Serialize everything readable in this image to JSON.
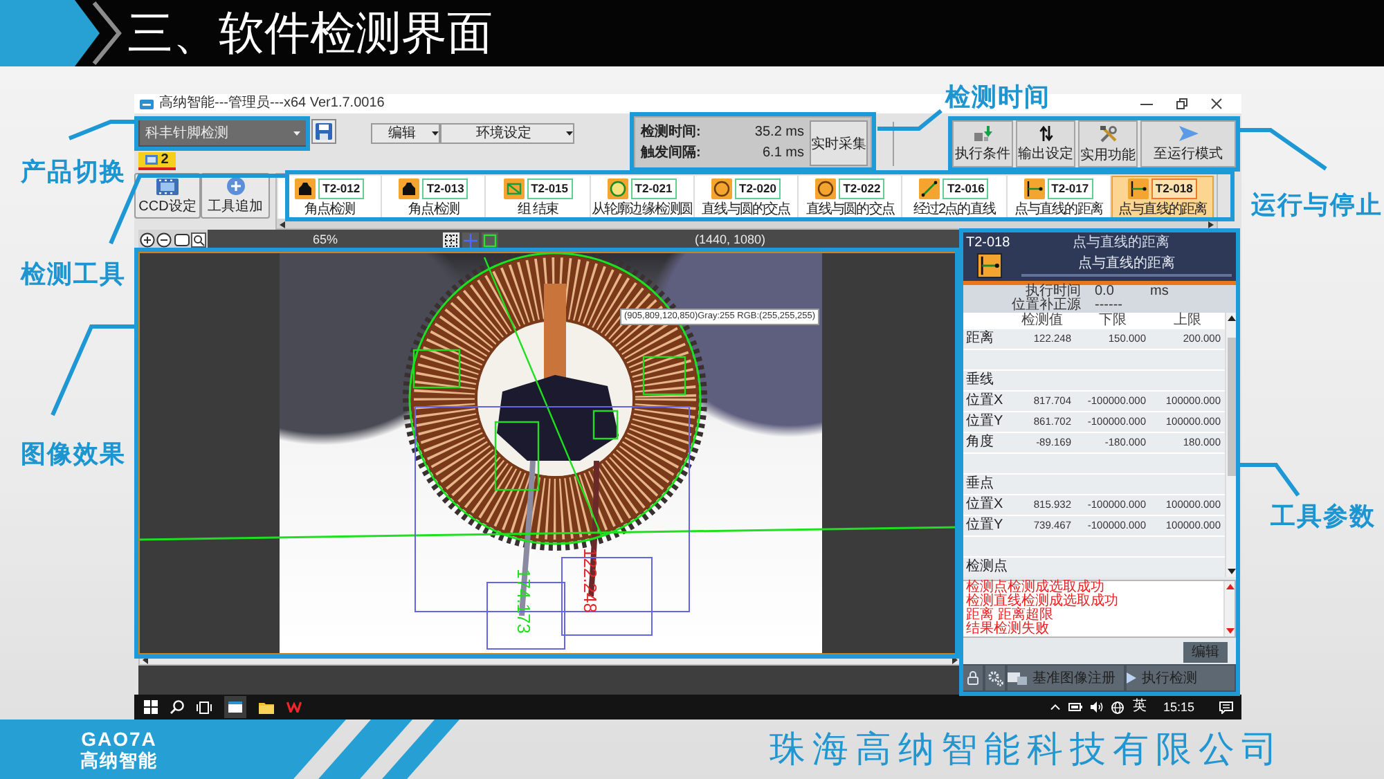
{
  "slide": {
    "title": "三、软件检测界面",
    "logo": {
      "wordmark": "GAO7A",
      "name": "高纳智能"
    },
    "company": "珠海高纳智能科技有限公司"
  },
  "annotations": [
    {
      "label": "产品切换"
    },
    {
      "label": "检测工具"
    },
    {
      "label": "图像效果"
    },
    {
      "label": "检测时间"
    },
    {
      "label": "运行与停止"
    },
    {
      "label": "工具参数"
    }
  ],
  "app": {
    "window": {
      "title": "高纳智能---管理员---x64 Ver1.7.0016"
    },
    "product_select": {
      "value": "科丰针脚检测"
    },
    "camera_tab": {
      "label": "2"
    },
    "menus": [
      {
        "label": "编辑"
      },
      {
        "label": "环境设定"
      }
    ],
    "timing": {
      "rows": [
        {
          "label": "检测时间:",
          "value": "35.2 ms"
        },
        {
          "label": "触发间隔:",
          "value": "6.1 ms"
        }
      ],
      "button": "实时采集"
    },
    "mode_buttons": [
      {
        "label": "执行条件",
        "kind": "conditions"
      },
      {
        "label": "输出设定",
        "kind": "output"
      },
      {
        "label": "实用功能",
        "kind": "utility"
      },
      {
        "label": "至运行模式",
        "kind": "run"
      }
    ],
    "setup_buttons": [
      {
        "label": "CCD设定",
        "kind": "camera"
      },
      {
        "label": "工具追加",
        "kind": "add"
      }
    ],
    "tools": [
      {
        "code": "T2-012",
        "label": "角点检测",
        "kind": "corner",
        "selected": false
      },
      {
        "code": "T2-013",
        "label": "角点检测",
        "kind": "corner",
        "selected": false
      },
      {
        "code": "T2-015",
        "label": "组 结束",
        "kind": "group",
        "selected": false
      },
      {
        "code": "T2-021",
        "label": "从轮廓边缘检测圆",
        "kind": "circle",
        "selected": false
      },
      {
        "code": "T2-020",
        "label": "直线与圆的交点",
        "kind": "intersection",
        "selected": false
      },
      {
        "code": "T2-022",
        "label": "直线与圆的交点",
        "kind": "intersection",
        "selected": false
      },
      {
        "code": "T2-016",
        "label": "经过2点的直线",
        "kind": "line",
        "selected": false
      },
      {
        "code": "T2-017",
        "label": "点与直线的距离",
        "kind": "distance",
        "selected": false
      },
      {
        "code": "T2-018",
        "label": "点与直线的距离",
        "kind": "distance",
        "selected": true
      }
    ],
    "viewer": {
      "zoom": "65%",
      "resolution": "(1440, 1080)",
      "pixel_info": "(905,809,120,850)Gray:255 RGB:(255,255,255)",
      "overlay_labels": [
        {
          "text": "174.173",
          "color": "#22dd22"
        },
        {
          "text": "122.248",
          "color": "#e02828"
        }
      ]
    },
    "tool_panel": {
      "code": "T2-018",
      "kind": "distance",
      "title": "点与直线的距离",
      "subtitle": "点与直线的距离",
      "info": [
        {
          "label": "执行时间",
          "value": "0.0",
          "unit": "ms"
        },
        {
          "label": "位置补正源",
          "value": "------"
        }
      ],
      "columns": [
        "检测值",
        "下限",
        "上限"
      ],
      "rows": [
        {
          "kind": "value",
          "name": "距离",
          "cells": [
            "122.248",
            "150.000",
            "200.000"
          ]
        },
        {
          "kind": "blank"
        },
        {
          "kind": "section",
          "name": "垂线"
        },
        {
          "kind": "value",
          "name": "位置X",
          "cells": [
            "817.704",
            "-100000.000",
            "100000.000"
          ]
        },
        {
          "kind": "value",
          "name": "位置Y",
          "cells": [
            "861.702",
            "-100000.000",
            "100000.000"
          ]
        },
        {
          "kind": "value",
          "name": "角度",
          "cells": [
            "-89.169",
            "-180.000",
            "180.000"
          ]
        },
        {
          "kind": "blank"
        },
        {
          "kind": "section",
          "name": "垂点"
        },
        {
          "kind": "value",
          "name": "位置X",
          "cells": [
            "815.932",
            "-100000.000",
            "100000.000"
          ]
        },
        {
          "kind": "value",
          "name": "位置Y",
          "cells": [
            "739.467",
            "-100000.000",
            "100000.000"
          ]
        },
        {
          "kind": "blank"
        },
        {
          "kind": "section",
          "name": "检测点"
        }
      ],
      "log": [
        "检测点检测成选取成功",
        "检测直线检测成选取成功",
        "距离 距离超限",
        "结果检测失败"
      ],
      "edit_button": "编辑",
      "actions": [
        {
          "label": "基准图像注册",
          "kind": "register"
        },
        {
          "label": "执行检测",
          "kind": "run"
        }
      ]
    },
    "taskbar": {
      "ime": "英",
      "time": "15:15"
    }
  }
}
